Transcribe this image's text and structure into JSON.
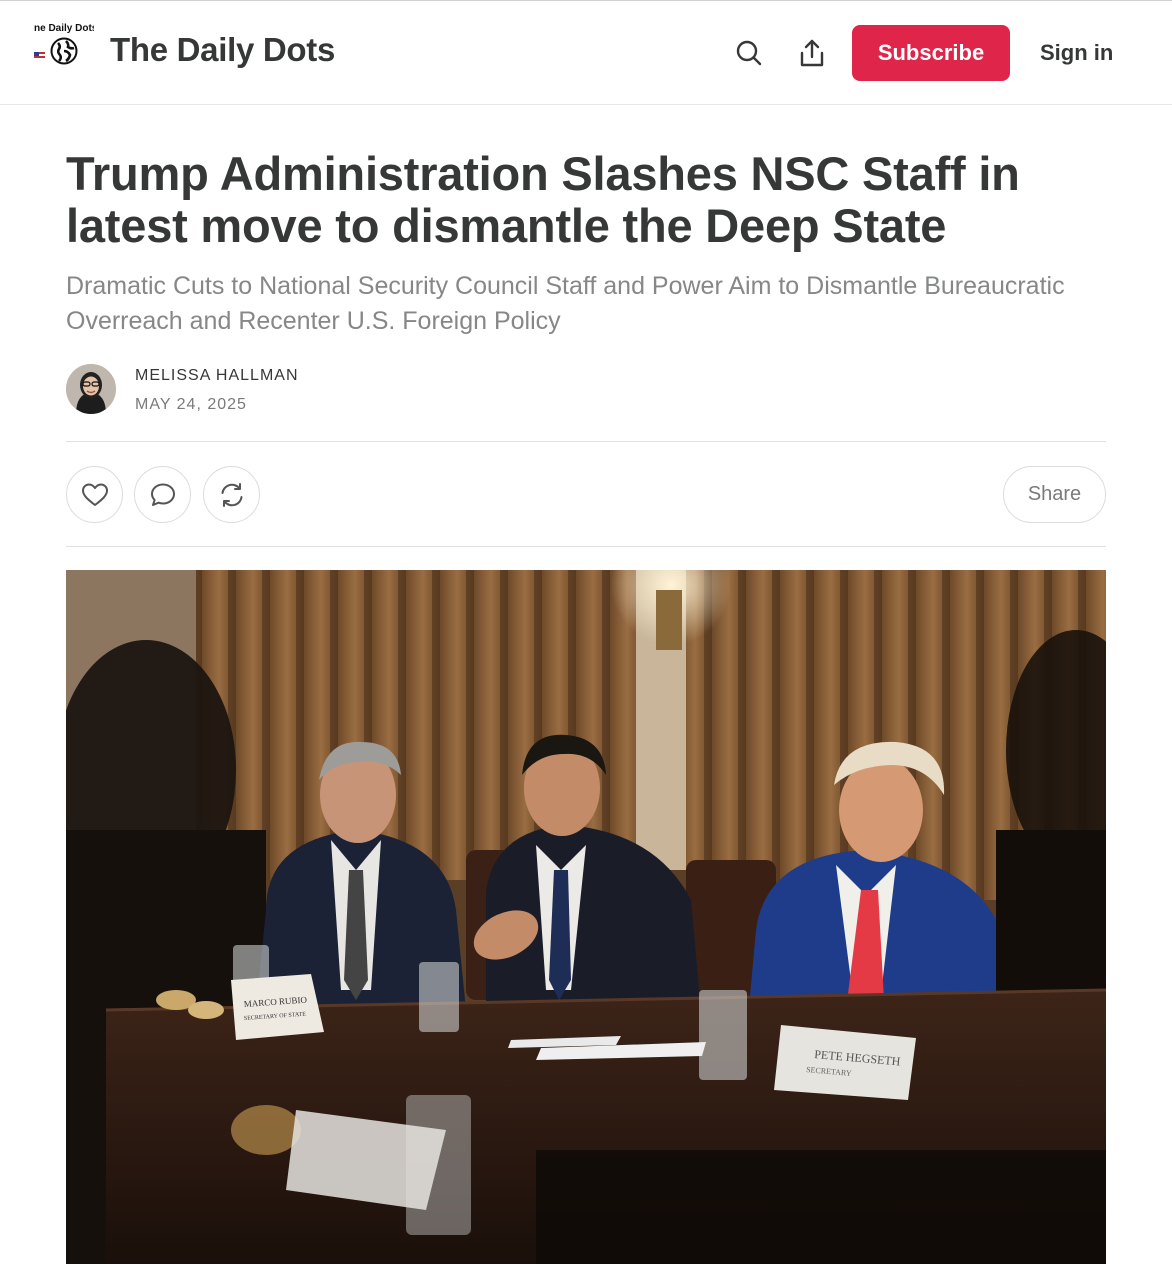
{
  "header": {
    "logo_text": "ne Daily Dots",
    "site_title": "The Daily Dots",
    "subscribe_label": "Subscribe",
    "signin_label": "Sign in",
    "icons": [
      "search-icon",
      "share-upload-icon"
    ]
  },
  "article": {
    "headline": "Trump Administration Slashes NSC Staff in latest move to dismantle the Deep State",
    "subtitle": "Dramatic Cuts to National Security Council Staff and Power Aim to Dismantle Bureaucratic Overreach and Recenter U.S. Foreign Policy",
    "author": "MELISSA HALLMAN",
    "date": "MAY 24, 2025"
  },
  "actions": {
    "icons": [
      "heart-icon",
      "comment-icon",
      "restack-icon"
    ],
    "share_label": "Share"
  },
  "photo": {
    "placards": [
      "MARCO RUBIO",
      "SECRETARY OF STATE",
      "PETE HEGSETH",
      "SECRETARY"
    ]
  },
  "colors": {
    "accent": "#e0254a",
    "text": "#363737",
    "muted": "#868787",
    "border": "#e0e0e0"
  }
}
